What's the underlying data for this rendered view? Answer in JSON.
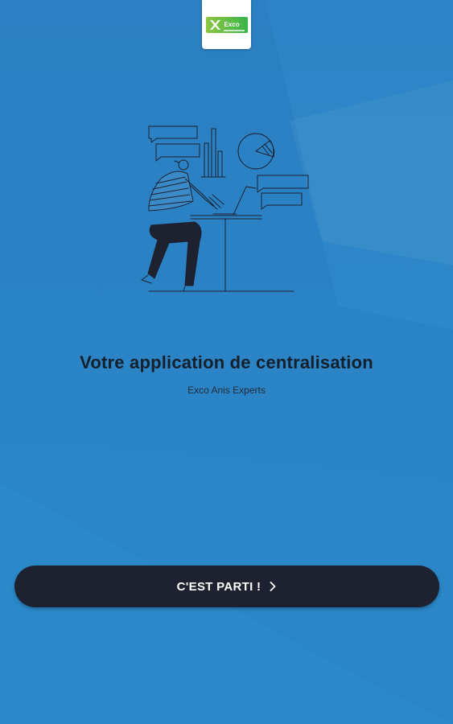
{
  "brand": {
    "logo_text": "Exco",
    "colors": {
      "background": "#2a80c3",
      "logo_green": "#39b54a",
      "logo_lime": "#8dc63f",
      "button": "#1d2130",
      "headline": "#16202c"
    }
  },
  "onboarding": {
    "illustration_icon": "person-at-desk-illustration",
    "headline": "Votre application de centralisation",
    "subtitle": "Exco Anis Experts"
  },
  "cta": {
    "label": "C'EST PARTI !",
    "icon": "chevron-right-icon"
  }
}
